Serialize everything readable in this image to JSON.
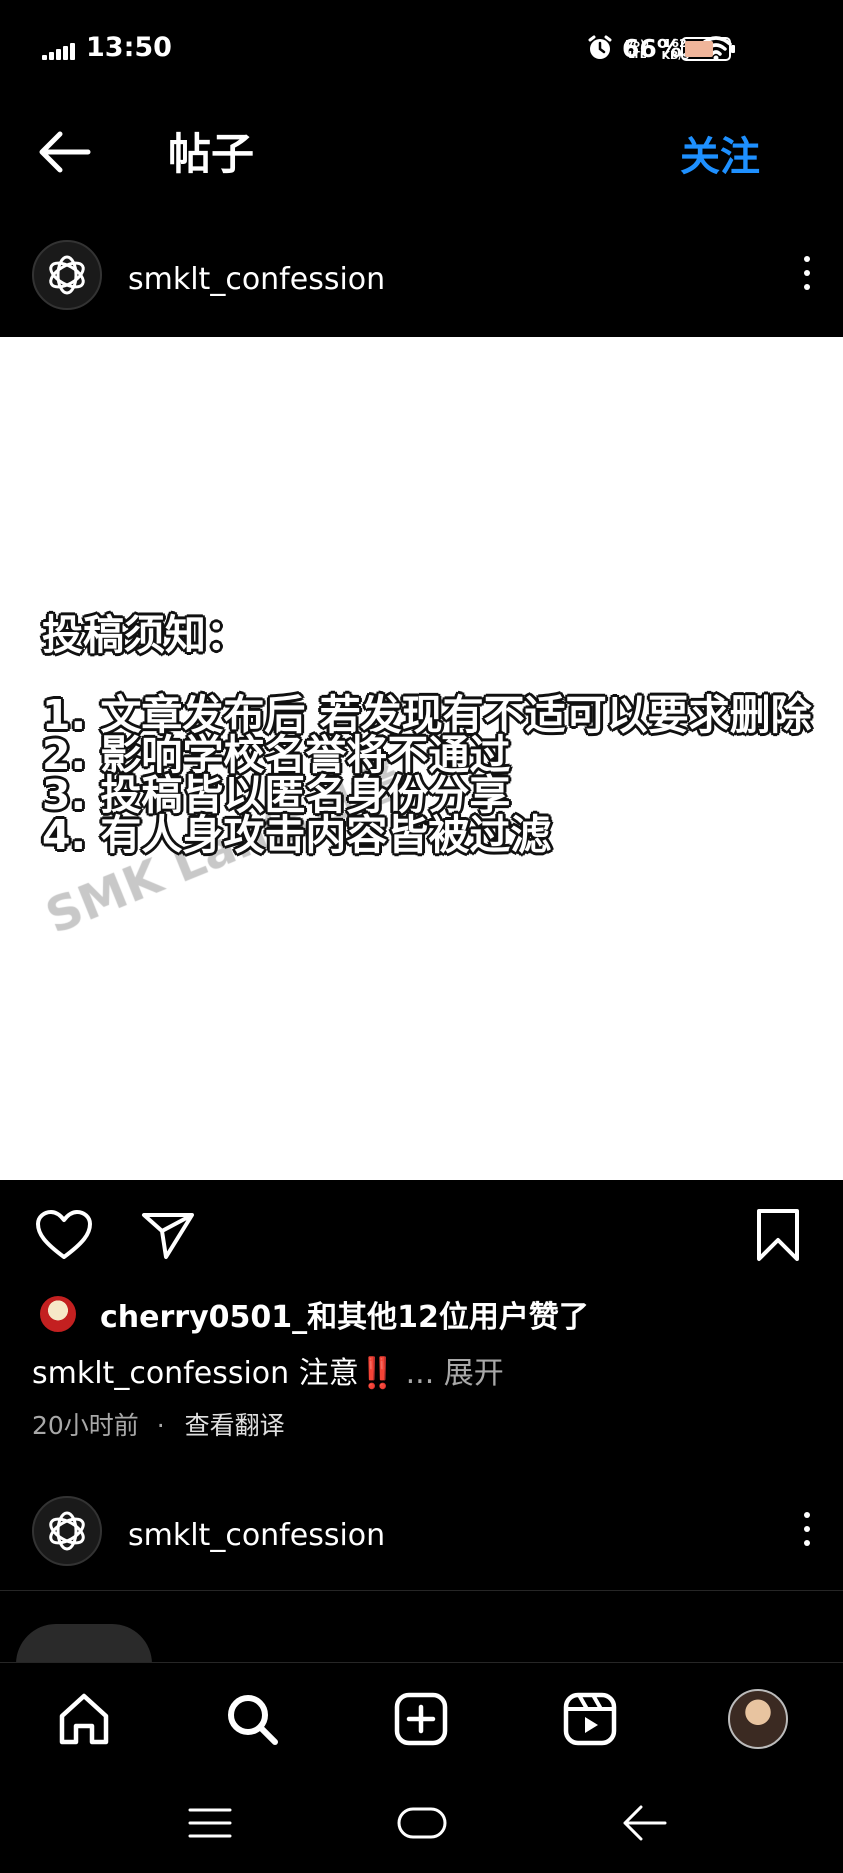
{
  "status_bar": {
    "time": "13:50",
    "volte_label": "Vo)) LTE",
    "speed_value": "162",
    "speed_unit": "KB/s",
    "battery_percent": "66%",
    "battery_level": 0.66
  },
  "header": {
    "title": "帖子",
    "follow_label": "关注"
  },
  "post": {
    "username": "smklt_confession",
    "image": {
      "heading": "投稿须知：",
      "rules": [
        "1. 文章发布后 若发现有不适可以要求删除",
        "2. 影响学校名誉将不通过",
        "3. 投稿皆以匿名身份分享",
        "4. 有人身攻击内容皆被过滤"
      ],
      "watermark": "SMK Lah告白墙"
    },
    "likes_text": "cherry0501_和其他12位用户赞了",
    "caption_user": "smklt_confession",
    "caption_text": "注意",
    "caption_emoji": "‼️",
    "caption_more": "... 展开",
    "time_ago": "20小时前",
    "separator": "·",
    "translate_label": "查看翻译"
  },
  "next_post": {
    "username": "smklt_confession"
  },
  "icons": {
    "back": "arrow-left-icon",
    "more": "more-vertical-icon",
    "like": "heart-icon",
    "share": "paper-plane-icon",
    "save": "bookmark-icon",
    "home": "home-icon",
    "search": "search-icon",
    "create": "plus-square-icon",
    "reels": "reels-icon",
    "profile": "profile-avatar"
  },
  "colors": {
    "background": "#000000",
    "accent": "#1e90ff",
    "secondary_text": "#a8a8a8",
    "alert": "#e11d2b"
  }
}
